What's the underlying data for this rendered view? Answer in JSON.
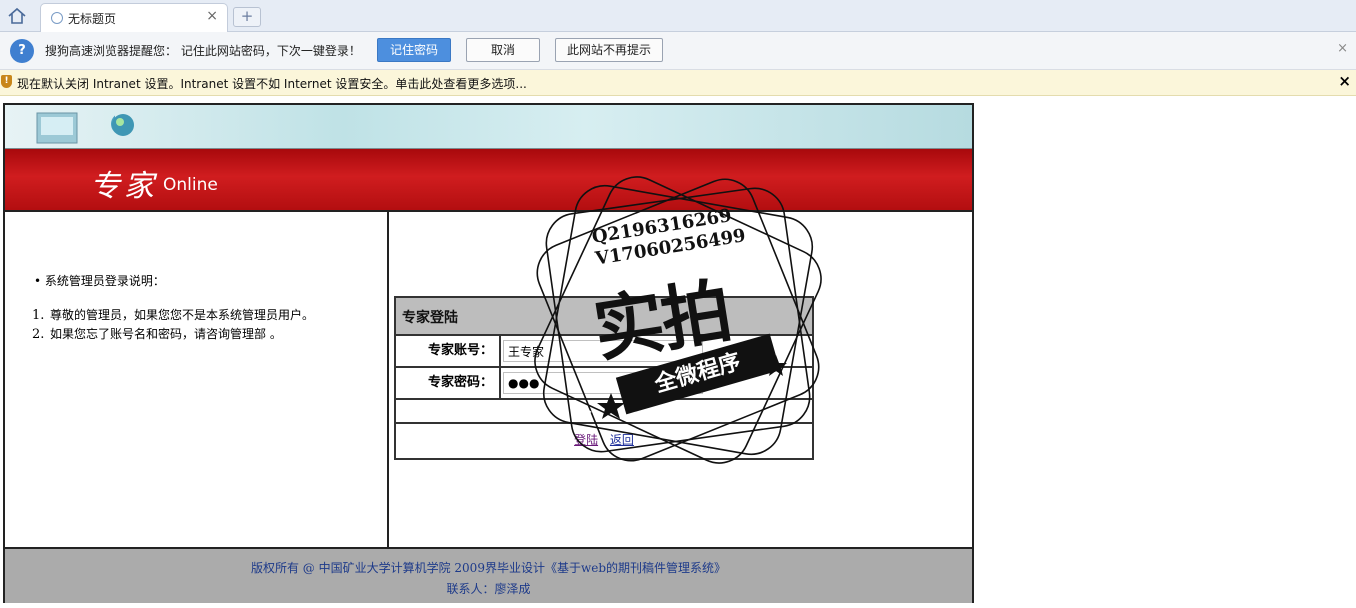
{
  "browser": {
    "tab_title": "无标题页",
    "tab_close": "×",
    "new_tab": "+"
  },
  "password_bar": {
    "icon": "key-icon",
    "message": "搜狗高速浏览器提醒您： 记住此网站密码，下次一键登录！",
    "remember_label": "记住密码",
    "cancel_label": "取消",
    "never_label": "此网站不再提示",
    "close": "×"
  },
  "info_bar": {
    "icon": "shield-icon",
    "message": "现在默认关闭 Intranet 设置。Intranet 设置不如 Internet 设置安全。单击此处查看更多选项...",
    "close": "×"
  },
  "banner": {
    "title_cn": "专家",
    "title_en": "Online"
  },
  "instructions": {
    "heading": "•  系统管理员登录说明：",
    "items": [
      {
        "num": "1.",
        "text": "尊敬的管理员，如果您您不是本系统管理员用户。"
      },
      {
        "num": "2.",
        "text": "如果您忘了账号名和密码，请咨询管理部 。"
      }
    ]
  },
  "login": {
    "header": "专家登陆",
    "account_label": "专家账号：",
    "account_value": "王专家",
    "password_label": "专家密码：",
    "password_value": "●●●",
    "login_link": "登陆",
    "back_link": "返回"
  },
  "footer": {
    "line1": "版权所有 @ 中国矿业大学计算机学院 2009界毕业设计《基于web的期刊稿件管理系统》",
    "line2": "联系人：廖泽成"
  },
  "watermark": {
    "line1": "Q2196316269",
    "line2": "V17060256499",
    "big": "实拍",
    "ribbon": "全微程序"
  }
}
